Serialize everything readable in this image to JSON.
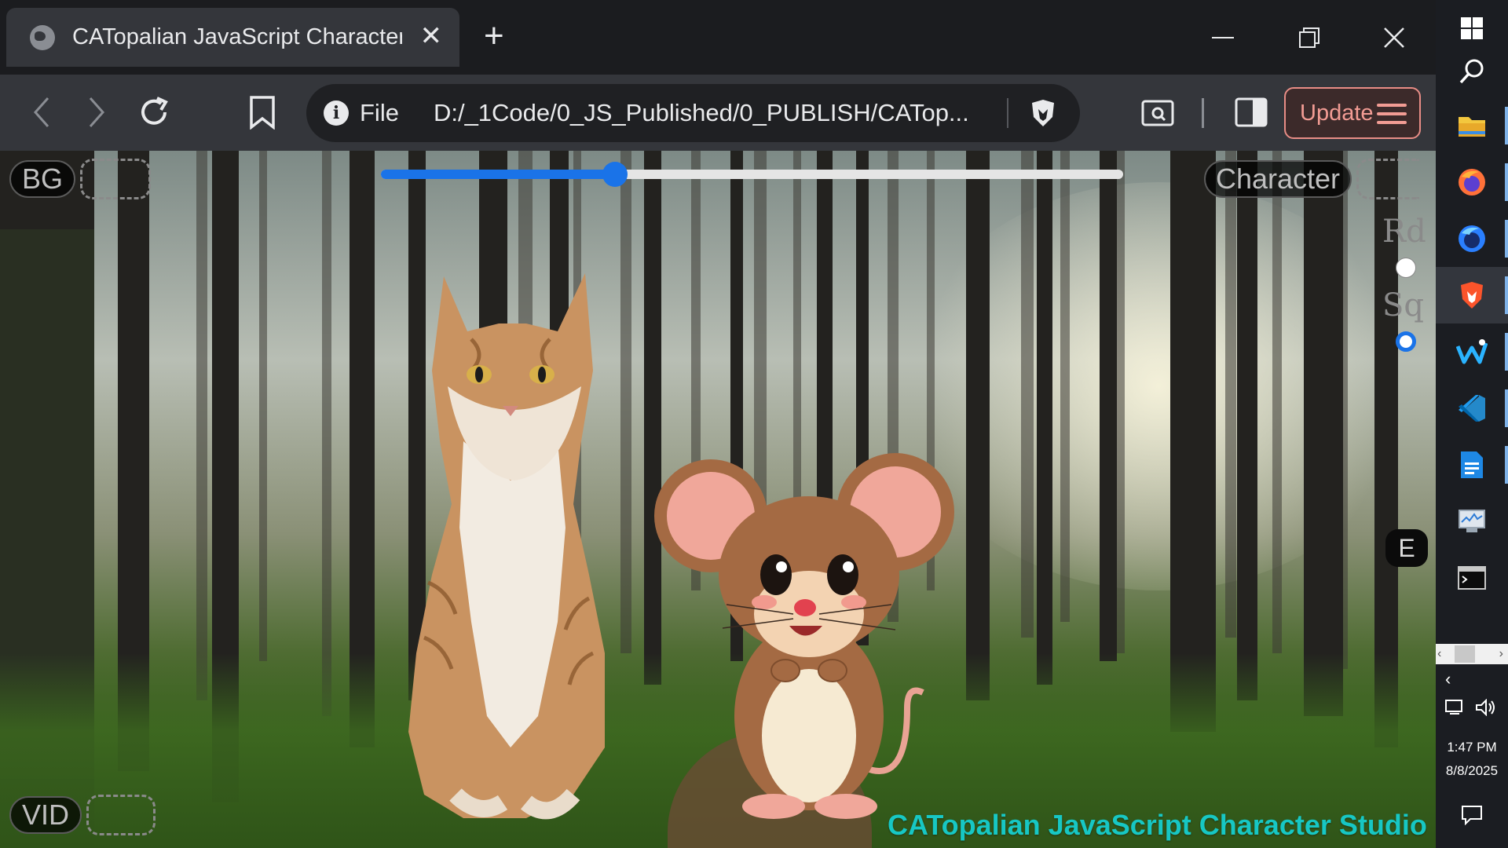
{
  "browser": {
    "tab_title": "CATopalian JavaScript Character Studio",
    "address_scheme": "File",
    "address_url": "D:/_1Code/0_JS_Published/0_PUBLISH/CATop...",
    "update_label": "Update"
  },
  "page": {
    "bg_label": "BG",
    "vid_label": "VID",
    "character_label": "Character",
    "shape_options": [
      "Rd",
      "Sq"
    ],
    "selected_shape": "Sq",
    "e_button_label": "E",
    "size_slider_fraction": 0.315,
    "studio_title": "CATopalian JavaScript Character Studio",
    "characters": [
      "cat",
      "mouse"
    ]
  },
  "taskbar": {
    "time": "1:47 PM",
    "date": "8/8/2025",
    "pinned": [
      "file-explorer",
      "firefox",
      "firefox-developer",
      "brave",
      "whiteboard",
      "vscode",
      "document-app",
      "task-manager",
      "terminal"
    ]
  },
  "colors": {
    "slider_accent": "#1a73e8",
    "studio_title": "#17c7c4",
    "update_accent": "#f29c94"
  }
}
